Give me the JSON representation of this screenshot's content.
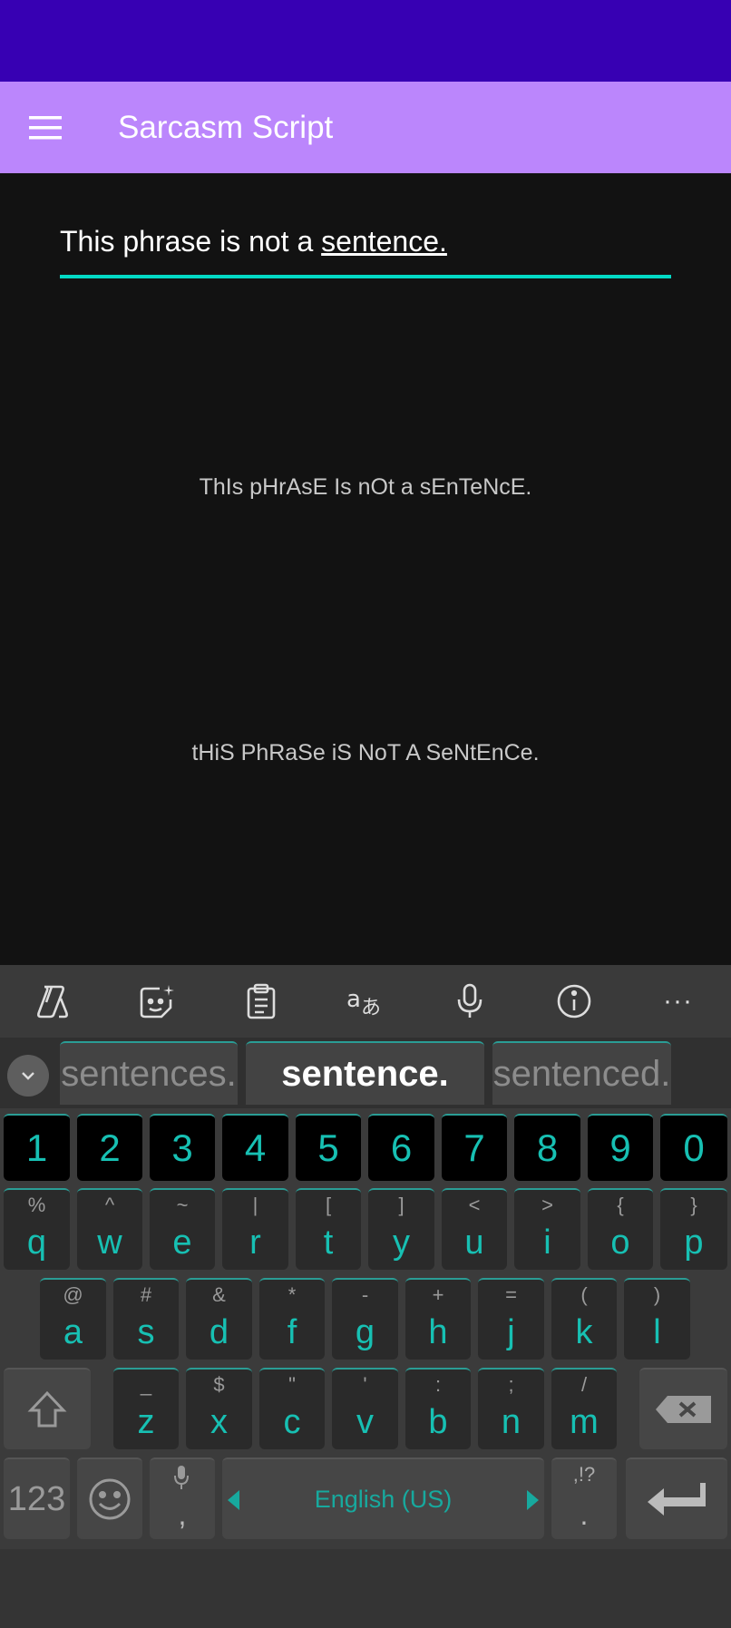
{
  "app": {
    "title": "Sarcasm Script"
  },
  "input": {
    "before": "This phrase is not a ",
    "composing": "sentence."
  },
  "results": {
    "alternating_1": "ThIs pHrAsE Is nOt a sEnTeNcE.",
    "alternating_2": "tHiS PhRaSe iS NoT A SeNtEnCe."
  },
  "keyboard": {
    "toolbar": [
      "copilot-icon",
      "sticker-icon",
      "clipboard-icon",
      "translate-icon",
      "microphone-icon",
      "info-icon",
      "more-icon"
    ],
    "toolbar_more": "···",
    "suggestions": [
      "sentences.",
      "sentence.",
      "sentenced."
    ],
    "numbers": [
      "1",
      "2",
      "3",
      "4",
      "5",
      "6",
      "7",
      "8",
      "9",
      "0"
    ],
    "row1": [
      {
        "main": "q",
        "sub": "%"
      },
      {
        "main": "w",
        "sub": "^"
      },
      {
        "main": "e",
        "sub": "~"
      },
      {
        "main": "r",
        "sub": "|"
      },
      {
        "main": "t",
        "sub": "["
      },
      {
        "main": "y",
        "sub": "]"
      },
      {
        "main": "u",
        "sub": "<"
      },
      {
        "main": "i",
        "sub": ">"
      },
      {
        "main": "o",
        "sub": "{"
      },
      {
        "main": "p",
        "sub": "}"
      }
    ],
    "row2": [
      {
        "main": "a",
        "sub": "@"
      },
      {
        "main": "s",
        "sub": "#"
      },
      {
        "main": "d",
        "sub": "&"
      },
      {
        "main": "f",
        "sub": "*"
      },
      {
        "main": "g",
        "sub": "-"
      },
      {
        "main": "h",
        "sub": "+"
      },
      {
        "main": "j",
        "sub": "="
      },
      {
        "main": "k",
        "sub": "("
      },
      {
        "main": "l",
        "sub": ")"
      }
    ],
    "row3": [
      {
        "main": "z",
        "sub": "_"
      },
      {
        "main": "x",
        "sub": "$"
      },
      {
        "main": "c",
        "sub": "\""
      },
      {
        "main": "v",
        "sub": "'"
      },
      {
        "main": "b",
        "sub": ":"
      },
      {
        "main": "n",
        "sub": ";"
      },
      {
        "main": "m",
        "sub": "/"
      }
    ],
    "symbols_key": "123",
    "comma": ",",
    "space_label": "English (US)",
    "period": ".",
    "period_sub": ",!?"
  }
}
